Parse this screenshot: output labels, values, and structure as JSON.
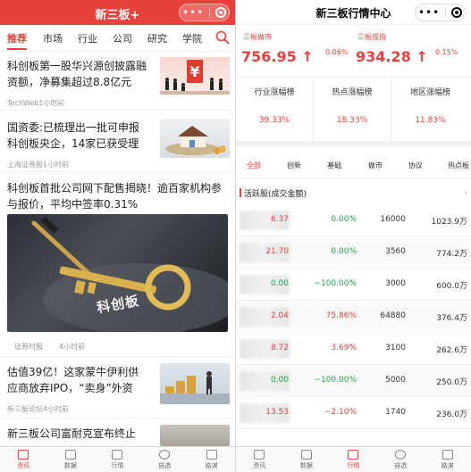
{
  "left": {
    "title": "新三板+",
    "tabs": [
      "推荐",
      "市场",
      "行业",
      "公司",
      "研究",
      "学院"
    ],
    "news": [
      {
        "headline_l1": "科创板第一股华兴源创披露融",
        "headline_l2": "资额，净募集超过8.8亿元",
        "source": "TechWeb1小时前"
      },
      {
        "headline_l1": "国资委:已梳理出一批可申报",
        "headline_l2": "科创板央企，14家已获受理",
        "source": "上海证券报1小时前"
      },
      {
        "headline_l1": "科创板首批公司网下配售揭晓！逾百家机构参",
        "headline_l2": "与报价，平均中签率0.31%",
        "source": "证券时报",
        "time": "4小时前",
        "banner_text": "科创板"
      },
      {
        "headline_l1": "估值39亿！这家蒙牛伊利供",
        "headline_l2": "应商放弃IPO，“卖身”外资",
        "source": "新三板论坛4小时前"
      },
      {
        "headline_l1": "新三板公司富耐克宣布终止",
        "headline_l2": "",
        "source": ""
      }
    ],
    "bottom_nav": [
      "资讯",
      "数据",
      "行情",
      "自选",
      "路演"
    ]
  },
  "right": {
    "title": "新三板行情中心",
    "indices": [
      {
        "label": "三板做市",
        "value": "756.95 ↑",
        "pct": "0.06%"
      },
      {
        "label": "三板成指",
        "value": "934.28 ↑",
        "pct": "0.15%"
      }
    ],
    "rankings": [
      {
        "title": "行业涨幅榜",
        "value": "39.33%"
      },
      {
        "title": "热点涨幅榜",
        "value": "18.33%"
      },
      {
        "title": "地区涨幅榜",
        "value": "11.83%"
      }
    ],
    "tabs": [
      "全部",
      "创新",
      "基础",
      "做市",
      "协议",
      "热点板"
    ],
    "section_label": "活跃股(成交金额)",
    "stocks": [
      {
        "price": "6.37",
        "change": "0.00%",
        "volume": "16000",
        "amount": "1023.9万",
        "price_color": "red",
        "change_color": "green"
      },
      {
        "price": "21.70",
        "change": "0.00%",
        "volume": "3560",
        "amount": "774.2万",
        "price_color": "red",
        "change_color": "green"
      },
      {
        "price": "0.00",
        "change": "−100.00%",
        "volume": "3000",
        "amount": "600.0万",
        "price_color": "green",
        "change_color": "green"
      },
      {
        "price": "2.04",
        "change": "75.86%",
        "volume": "64880",
        "amount": "376.4万",
        "price_color": "red",
        "change_color": "red"
      },
      {
        "price": "8.72",
        "change": "3.69%",
        "volume": "3100",
        "amount": "262.6万",
        "price_color": "red",
        "change_color": "red"
      },
      {
        "price": "0.00",
        "change": "−100.00%",
        "volume": "5000",
        "amount": "250.0万",
        "price_color": "green",
        "change_color": "green"
      },
      {
        "price": "13.53",
        "change": "−2.10%",
        "volume": "1740",
        "amount": "236.0万",
        "price_color": "red",
        "change_color": "red"
      }
    ],
    "bottom_nav": [
      "资讯",
      "数据",
      "行情",
      "自选",
      "路演"
    ]
  },
  "colors": {
    "accent": "#e8413c",
    "up": "#e8413c",
    "down": "#1aa64a"
  }
}
